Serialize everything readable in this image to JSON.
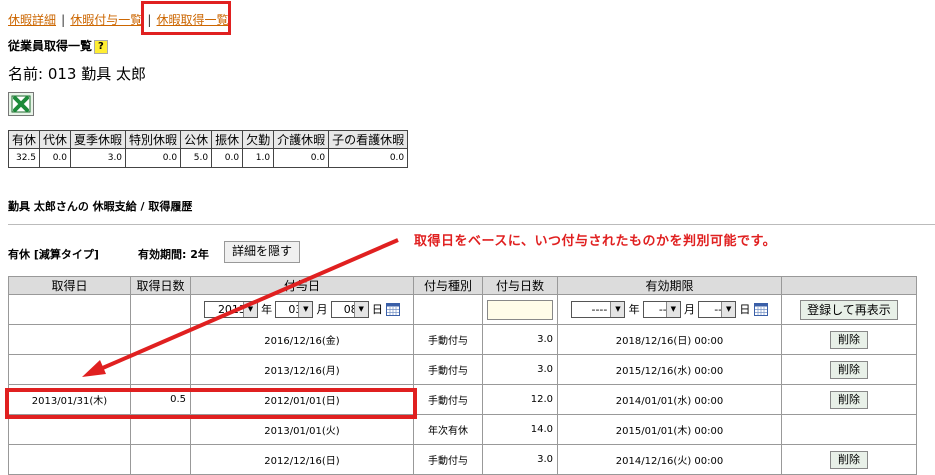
{
  "nav": {
    "links": [
      "休暇詳細",
      "休暇付与一覧",
      "休暇取得一覧"
    ],
    "separator": "|"
  },
  "header": {
    "title": "従業員取得一覧",
    "help": "?",
    "name": "名前: 013 勤具 太郎"
  },
  "summary": {
    "headers": [
      "有休",
      "代休",
      "夏季休暇",
      "特別休暇",
      "公休",
      "振休",
      "欠勤",
      "介護休暇",
      "子の看護休暇"
    ],
    "values": [
      "32.5",
      "0.0",
      "3.0",
      "0.0",
      "5.0",
      "0.0",
      "1.0",
      "0.0",
      "0.0"
    ]
  },
  "section_title": "勤具 太郎さんの 休暇支給 / 取得履歴",
  "annotation": "取得日をベースに、いつ付与されたものかを判別可能です。",
  "subheader": {
    "type_label": "有休 [減算タイプ]",
    "validity": "有効期間: 2年",
    "detail_button": "詳細を隠す"
  },
  "table": {
    "headers": [
      "取得日",
      "取得日数",
      "付与日",
      "付与種別",
      "付与日数",
      "有効期限",
      ""
    ],
    "filter": {
      "year": "2013",
      "year_unit": "年",
      "month": "03",
      "month_unit": "月",
      "day": "08",
      "day_unit": "日",
      "exp_year": "----",
      "exp_year_unit": "年",
      "exp_month": "--",
      "exp_month_unit": "月",
      "exp_day": "--",
      "exp_day_unit": "日",
      "submit": "登録して再表示"
    },
    "rows": [
      {
        "acquired": "",
        "days": "",
        "granted": "2016/12/16(金)",
        "kind": "手動付与",
        "grant_days": "3.0",
        "expiry": "2018/12/16(日) 00:00",
        "action": "削除"
      },
      {
        "acquired": "",
        "days": "",
        "granted": "2013/12/16(月)",
        "kind": "手動付与",
        "grant_days": "3.0",
        "expiry": "2015/12/16(水) 00:00",
        "action": "削除"
      },
      {
        "acquired": "2013/01/31(木)",
        "days": "0.5",
        "granted": "2012/01/01(日)",
        "kind": "手動付与",
        "grant_days": "12.0",
        "expiry": "2014/01/01(水) 00:00",
        "action": "削除"
      },
      {
        "acquired": "",
        "days": "",
        "granted": "2013/01/01(火)",
        "kind": "年次有休",
        "grant_days": "14.0",
        "expiry": "2015/01/01(木) 00:00",
        "action": ""
      },
      {
        "acquired": "",
        "days": "",
        "granted": "2012/12/16(日)",
        "kind": "手動付与",
        "grant_days": "3.0",
        "expiry": "2014/12/16(火) 00:00",
        "action": "削除"
      }
    ]
  }
}
